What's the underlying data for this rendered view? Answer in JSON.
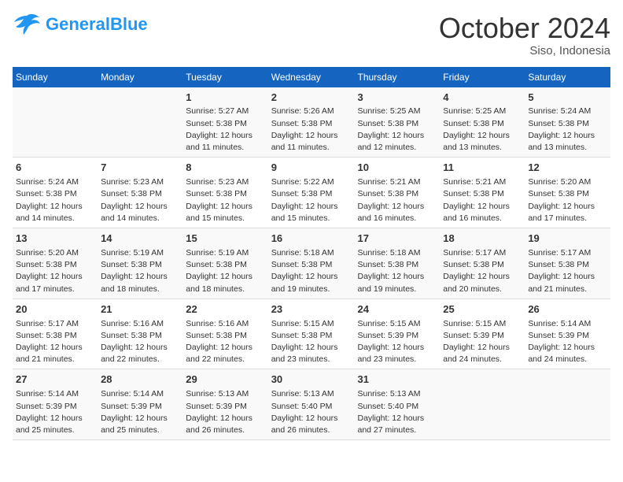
{
  "header": {
    "logo_general": "General",
    "logo_blue": "Blue",
    "month_title": "October 2024",
    "location": "Siso, Indonesia"
  },
  "days_of_week": [
    "Sunday",
    "Monday",
    "Tuesday",
    "Wednesday",
    "Thursday",
    "Friday",
    "Saturday"
  ],
  "weeks": [
    [
      {
        "day": "",
        "lines": []
      },
      {
        "day": "",
        "lines": []
      },
      {
        "day": "1",
        "lines": [
          "Sunrise: 5:27 AM",
          "Sunset: 5:38 PM",
          "Daylight: 12 hours",
          "and 11 minutes."
        ]
      },
      {
        "day": "2",
        "lines": [
          "Sunrise: 5:26 AM",
          "Sunset: 5:38 PM",
          "Daylight: 12 hours",
          "and 11 minutes."
        ]
      },
      {
        "day": "3",
        "lines": [
          "Sunrise: 5:25 AM",
          "Sunset: 5:38 PM",
          "Daylight: 12 hours",
          "and 12 minutes."
        ]
      },
      {
        "day": "4",
        "lines": [
          "Sunrise: 5:25 AM",
          "Sunset: 5:38 PM",
          "Daylight: 12 hours",
          "and 13 minutes."
        ]
      },
      {
        "day": "5",
        "lines": [
          "Sunrise: 5:24 AM",
          "Sunset: 5:38 PM",
          "Daylight: 12 hours",
          "and 13 minutes."
        ]
      }
    ],
    [
      {
        "day": "6",
        "lines": [
          "Sunrise: 5:24 AM",
          "Sunset: 5:38 PM",
          "Daylight: 12 hours",
          "and 14 minutes."
        ]
      },
      {
        "day": "7",
        "lines": [
          "Sunrise: 5:23 AM",
          "Sunset: 5:38 PM",
          "Daylight: 12 hours",
          "and 14 minutes."
        ]
      },
      {
        "day": "8",
        "lines": [
          "Sunrise: 5:23 AM",
          "Sunset: 5:38 PM",
          "Daylight: 12 hours",
          "and 15 minutes."
        ]
      },
      {
        "day": "9",
        "lines": [
          "Sunrise: 5:22 AM",
          "Sunset: 5:38 PM",
          "Daylight: 12 hours",
          "and 15 minutes."
        ]
      },
      {
        "day": "10",
        "lines": [
          "Sunrise: 5:21 AM",
          "Sunset: 5:38 PM",
          "Daylight: 12 hours",
          "and 16 minutes."
        ]
      },
      {
        "day": "11",
        "lines": [
          "Sunrise: 5:21 AM",
          "Sunset: 5:38 PM",
          "Daylight: 12 hours",
          "and 16 minutes."
        ]
      },
      {
        "day": "12",
        "lines": [
          "Sunrise: 5:20 AM",
          "Sunset: 5:38 PM",
          "Daylight: 12 hours",
          "and 17 minutes."
        ]
      }
    ],
    [
      {
        "day": "13",
        "lines": [
          "Sunrise: 5:20 AM",
          "Sunset: 5:38 PM",
          "Daylight: 12 hours",
          "and 17 minutes."
        ]
      },
      {
        "day": "14",
        "lines": [
          "Sunrise: 5:19 AM",
          "Sunset: 5:38 PM",
          "Daylight: 12 hours",
          "and 18 minutes."
        ]
      },
      {
        "day": "15",
        "lines": [
          "Sunrise: 5:19 AM",
          "Sunset: 5:38 PM",
          "Daylight: 12 hours",
          "and 18 minutes."
        ]
      },
      {
        "day": "16",
        "lines": [
          "Sunrise: 5:18 AM",
          "Sunset: 5:38 PM",
          "Daylight: 12 hours",
          "and 19 minutes."
        ]
      },
      {
        "day": "17",
        "lines": [
          "Sunrise: 5:18 AM",
          "Sunset: 5:38 PM",
          "Daylight: 12 hours",
          "and 19 minutes."
        ]
      },
      {
        "day": "18",
        "lines": [
          "Sunrise: 5:17 AM",
          "Sunset: 5:38 PM",
          "Daylight: 12 hours",
          "and 20 minutes."
        ]
      },
      {
        "day": "19",
        "lines": [
          "Sunrise: 5:17 AM",
          "Sunset: 5:38 PM",
          "Daylight: 12 hours",
          "and 21 minutes."
        ]
      }
    ],
    [
      {
        "day": "20",
        "lines": [
          "Sunrise: 5:17 AM",
          "Sunset: 5:38 PM",
          "Daylight: 12 hours",
          "and 21 minutes."
        ]
      },
      {
        "day": "21",
        "lines": [
          "Sunrise: 5:16 AM",
          "Sunset: 5:38 PM",
          "Daylight: 12 hours",
          "and 22 minutes."
        ]
      },
      {
        "day": "22",
        "lines": [
          "Sunrise: 5:16 AM",
          "Sunset: 5:38 PM",
          "Daylight: 12 hours",
          "and 22 minutes."
        ]
      },
      {
        "day": "23",
        "lines": [
          "Sunrise: 5:15 AM",
          "Sunset: 5:38 PM",
          "Daylight: 12 hours",
          "and 23 minutes."
        ]
      },
      {
        "day": "24",
        "lines": [
          "Sunrise: 5:15 AM",
          "Sunset: 5:39 PM",
          "Daylight: 12 hours",
          "and 23 minutes."
        ]
      },
      {
        "day": "25",
        "lines": [
          "Sunrise: 5:15 AM",
          "Sunset: 5:39 PM",
          "Daylight: 12 hours",
          "and 24 minutes."
        ]
      },
      {
        "day": "26",
        "lines": [
          "Sunrise: 5:14 AM",
          "Sunset: 5:39 PM",
          "Daylight: 12 hours",
          "and 24 minutes."
        ]
      }
    ],
    [
      {
        "day": "27",
        "lines": [
          "Sunrise: 5:14 AM",
          "Sunset: 5:39 PM",
          "Daylight: 12 hours",
          "and 25 minutes."
        ]
      },
      {
        "day": "28",
        "lines": [
          "Sunrise: 5:14 AM",
          "Sunset: 5:39 PM",
          "Daylight: 12 hours",
          "and 25 minutes."
        ]
      },
      {
        "day": "29",
        "lines": [
          "Sunrise: 5:13 AM",
          "Sunset: 5:39 PM",
          "Daylight: 12 hours",
          "and 26 minutes."
        ]
      },
      {
        "day": "30",
        "lines": [
          "Sunrise: 5:13 AM",
          "Sunset: 5:40 PM",
          "Daylight: 12 hours",
          "and 26 minutes."
        ]
      },
      {
        "day": "31",
        "lines": [
          "Sunrise: 5:13 AM",
          "Sunset: 5:40 PM",
          "Daylight: 12 hours",
          "and 27 minutes."
        ]
      },
      {
        "day": "",
        "lines": []
      },
      {
        "day": "",
        "lines": []
      }
    ]
  ]
}
